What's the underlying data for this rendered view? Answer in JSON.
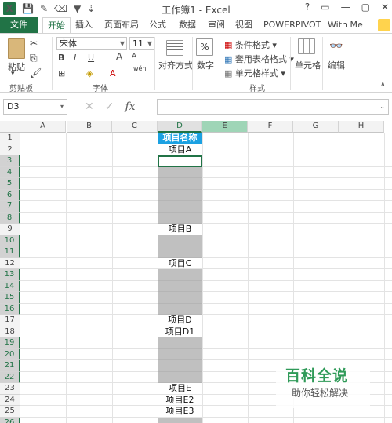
{
  "window": {
    "title": "工作簿1 - Excel",
    "controls": [
      "?",
      "▭",
      "—",
      "▢",
      "✕"
    ]
  },
  "qat": {
    "logo": "X"
  },
  "tabs": {
    "file": "文件",
    "items": [
      "开始",
      "插入",
      "页面布局",
      "公式",
      "数据",
      "审阅",
      "视图",
      "POWERPIVOT",
      "With Me"
    ],
    "active": "开始"
  },
  "ribbon": {
    "clipboard": {
      "paste": "粘贴",
      "group": "剪贴板"
    },
    "font": {
      "family": "宋体",
      "size": "11",
      "bold": "B",
      "italic": "I",
      "underline": "U",
      "grow": "A",
      "shrink": "A",
      "fontcolor": "A",
      "wen": "wén",
      "group": "字体"
    },
    "alignment": {
      "label": "对齐方式"
    },
    "number": {
      "label": "数字",
      "symbol": "%"
    },
    "styles": {
      "conditional": "条件格式",
      "table": "套用表格格式",
      "cell": "单元格样式",
      "group": "样式"
    },
    "cells": {
      "label": "单元格"
    },
    "editing": {
      "label": "编辑"
    }
  },
  "formula_bar": {
    "name_box": "D3",
    "cancel": "✕",
    "enter": "✓",
    "fx": "fx",
    "value": ""
  },
  "sheet": {
    "columns": [
      "A",
      "B",
      "C",
      "D",
      "E",
      "F",
      "G",
      "H"
    ],
    "selected_column": "D",
    "rows": [
      {
        "n": "1",
        "d": "项目名称",
        "kind": "header"
      },
      {
        "n": "2",
        "d": "项目A",
        "kind": "text"
      },
      {
        "n": "3",
        "d": "",
        "kind": "active"
      },
      {
        "n": "4",
        "d": "",
        "kind": "blank"
      },
      {
        "n": "5",
        "d": "",
        "kind": "blank"
      },
      {
        "n": "6",
        "d": "",
        "kind": "blank"
      },
      {
        "n": "7",
        "d": "",
        "kind": "blank"
      },
      {
        "n": "8",
        "d": "",
        "kind": "blank"
      },
      {
        "n": "9",
        "d": "项目B",
        "kind": "text"
      },
      {
        "n": "10",
        "d": "",
        "kind": "blank"
      },
      {
        "n": "11",
        "d": "",
        "kind": "blank"
      },
      {
        "n": "12",
        "d": "项目C",
        "kind": "text"
      },
      {
        "n": "13",
        "d": "",
        "kind": "blank"
      },
      {
        "n": "14",
        "d": "",
        "kind": "blank"
      },
      {
        "n": "15",
        "d": "",
        "kind": "blank"
      },
      {
        "n": "16",
        "d": "",
        "kind": "blank"
      },
      {
        "n": "17",
        "d": "项目D",
        "kind": "text"
      },
      {
        "n": "18",
        "d": "项目D1",
        "kind": "text"
      },
      {
        "n": "19",
        "d": "",
        "kind": "blank"
      },
      {
        "n": "20",
        "d": "",
        "kind": "blank"
      },
      {
        "n": "21",
        "d": "",
        "kind": "blank"
      },
      {
        "n": "22",
        "d": "",
        "kind": "blank"
      },
      {
        "n": "23",
        "d": "项目E",
        "kind": "text"
      },
      {
        "n": "24",
        "d": "项目E2",
        "kind": "text"
      },
      {
        "n": "25",
        "d": "项目E3",
        "kind": "text"
      },
      {
        "n": "26",
        "d": "",
        "kind": "blank"
      }
    ]
  },
  "watermark": {
    "line1": "百科全说",
    "line2": "助你轻松解决"
  },
  "colors": {
    "excel_green": "#217346",
    "header_blue": "#1ba1e2",
    "blank_gray": "#c0c0c0"
  }
}
